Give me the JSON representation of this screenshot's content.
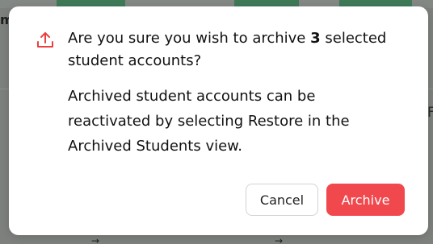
{
  "background": {
    "left_fragment": "m",
    "right_fragment": "F",
    "arrow_glyph": "→"
  },
  "dialog": {
    "icon": "upload-arrow-icon",
    "title_prefix": "Are you sure you wish to archive ",
    "title_count": "3",
    "title_suffix": " selected student accounts?",
    "body": "Archived student accounts can be reactivated by selecting Restore in the Archived Students view.",
    "cancel_label": "Cancel",
    "archive_label": "Archive"
  },
  "colors": {
    "accent": "#f0484d",
    "icon": "#e8403f",
    "overlay": "#7d807d"
  }
}
